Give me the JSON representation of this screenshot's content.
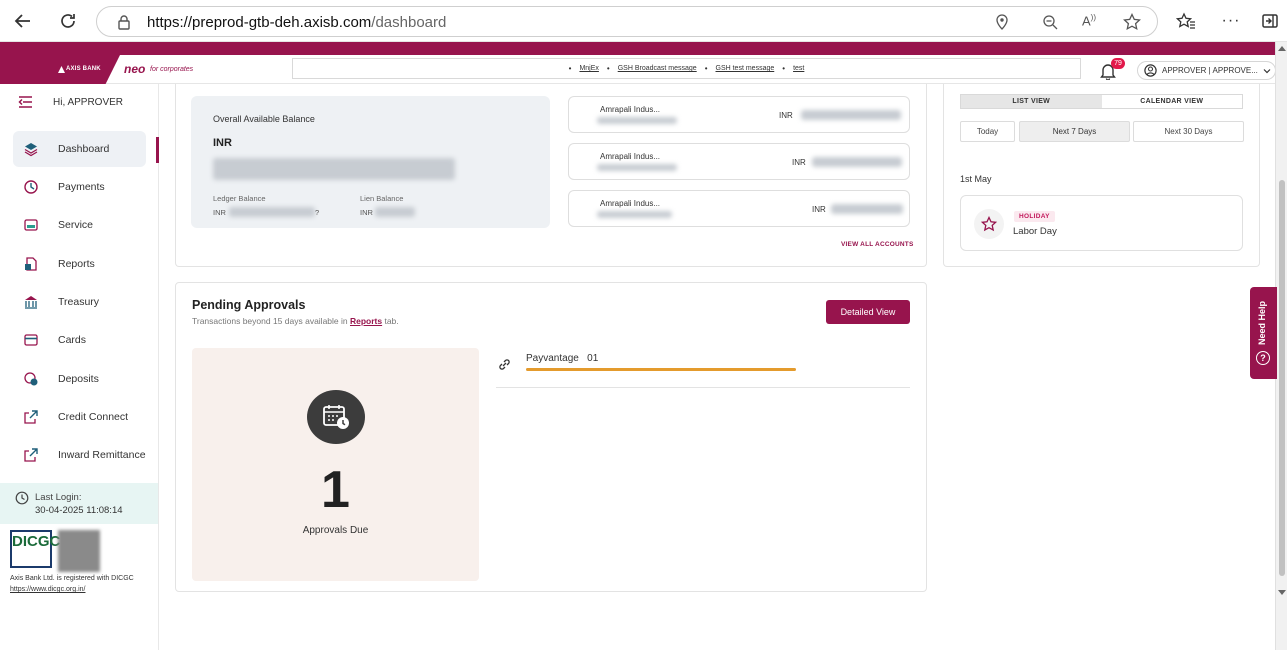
{
  "browser": {
    "url_host": "https://preprod-gtb-deh.axisb.com",
    "url_path": "/dashboard"
  },
  "header": {
    "bank_name": "AXIS BANK",
    "product": "neo",
    "product_sub": "for corporates",
    "ticker": [
      "MnjEx",
      "GSH Broadcast message",
      "GSH test message",
      "test"
    ],
    "notifications": "79",
    "user": "APPROVER | APPROVE..."
  },
  "sidebar": {
    "greeting": "Hi, APPROVER",
    "items": [
      {
        "label": "Dashboard",
        "icon": "layers-icon"
      },
      {
        "label": "Payments",
        "icon": "payments-icon"
      },
      {
        "label": "Service",
        "icon": "service-icon"
      },
      {
        "label": "Reports",
        "icon": "reports-icon"
      },
      {
        "label": "Treasury",
        "icon": "bank-icon"
      },
      {
        "label": "Cards",
        "icon": "card-icon"
      },
      {
        "label": "Deposits",
        "icon": "deposits-icon"
      },
      {
        "label": "Credit Connect",
        "icon": "external-link-icon"
      },
      {
        "label": "Inward Remittance",
        "icon": "external-link-icon"
      }
    ],
    "last_login_label": "Last Login:",
    "last_login_time": "30-04-2025  11:08:14",
    "dicgc_logo": "DICGC",
    "dicgc_text": "Axis Bank Ltd. is registered with DICGC",
    "dicgc_link": "https://www.dicgc.org.in/"
  },
  "balance": {
    "title": "Overall Available Balance",
    "currency": "INR",
    "ledger_label": "Ledger Balance",
    "ledger_prefix": "INR",
    "ledger_suffix": "?",
    "lien_label": "Lien Balance",
    "lien_prefix": "INR"
  },
  "accounts": [
    {
      "name": "Amrapali Indus...",
      "currency": "INR"
    },
    {
      "name": "Amrapali Indus...",
      "currency": "INR"
    },
    {
      "name": "Amrapali Indus...",
      "currency": "INR"
    }
  ],
  "view_all": "VIEW ALL ACCOUNTS",
  "pending": {
    "title": "Pending Approvals",
    "subtitle_pre": "Transactions beyond 15 days available in ",
    "subtitle_link": "Reports",
    "subtitle_post": " tab.",
    "button": "Detailed View",
    "count": "1",
    "count_label": "Approvals Due",
    "item_label": "Payvantage   01"
  },
  "calendar": {
    "tabs": [
      "LIST VIEW",
      "CALENDAR VIEW"
    ],
    "ranges": [
      "Today",
      "Next 7 Days",
      "Next 30 Days"
    ],
    "date": "1st May",
    "event_tag": "HOLIDAY",
    "event_name": "Labor Day"
  },
  "help": {
    "label": "Need Help",
    "q": "?"
  },
  "colors": {
    "brand": "#97144d",
    "accent": "#e49b2d"
  }
}
